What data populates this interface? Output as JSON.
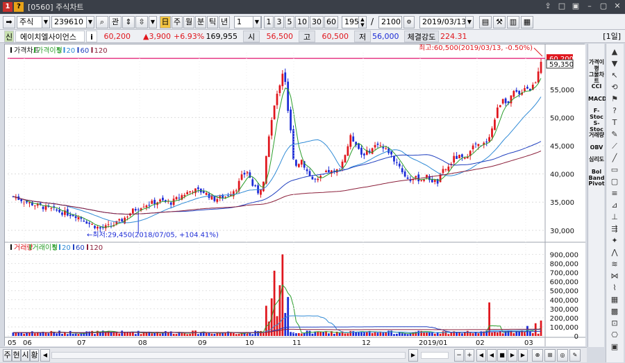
{
  "window": {
    "title": "[0560] 주식차트",
    "icon_q": "?",
    "icon_num": "1"
  },
  "toolbar": {
    "market": "주식",
    "code": "239610",
    "btn_gwan": "관",
    "period_buttons": [
      "주",
      "월",
      "분",
      "틱",
      "년"
    ],
    "interval_value": "1",
    "minute_buttons": [
      "1",
      "3",
      "5",
      "10",
      "30",
      "60"
    ],
    "count_value": "195",
    "total_value": "2100",
    "date_value": "2019/03/13"
  },
  "quote": {
    "badge": "신",
    "name": "에이치엘사이언스",
    "info_btn": "i",
    "price": "60,200",
    "change": "▲3,900",
    "change_pct": "+6.93%",
    "volume": "169,955",
    "open_label": "시",
    "open": "56,500",
    "high_label": "고",
    "high": "60,500",
    "low_label": "저",
    "low": "56,000",
    "strength_label": "체결강도",
    "strength": "224.31",
    "period_tag": "[1일]"
  },
  "price_pane": {
    "legend_title": "가격차트",
    "legend_ma_label": "가격이평",
    "legend_ma_periods": [
      "5",
      "20",
      "60",
      "120"
    ],
    "high_annotation": "최고:60,500(2019/03/13, -0.50%)",
    "low_annotation": "←최저:29,450(2018/07/05, +104.41%)",
    "current_price_tag": "59,350",
    "prev_tag": "60,200",
    "y_ticks": [
      "55,000",
      "50,000",
      "45,000",
      "40,000",
      "35,000",
      "30,000"
    ]
  },
  "volume_pane": {
    "legend_title": "거래량",
    "legend_ma_label": "거래이평",
    "legend_ma_periods": [
      "5",
      "20",
      "60",
      "120"
    ],
    "y_ticks": [
      "900,000",
      "800,000",
      "700,000",
      "600,000",
      "500,000",
      "400,000",
      "300,000",
      "200,000",
      "100,000",
      "0"
    ]
  },
  "x_axis_labels": [
    "05",
    "06",
    "07",
    "08",
    "09",
    "10",
    "11",
    "12",
    "2019/01",
    "02",
    "03"
  ],
  "bottom": {
    "tab1": "주",
    "tab2": "현",
    "tab3": "시",
    "tab4": "황"
  },
  "indicators": [
    "가격이평",
    "그물차트",
    "CCI",
    "MACD",
    "F-Stoc",
    "S-Stoc",
    "거래량",
    "OBV",
    "심리도",
    "Bol Band",
    "Pivot"
  ],
  "colors": {
    "up": "#e0161d",
    "down": "#1c2bd6",
    "ma5": "#2a9d2a",
    "ma20": "#2f8ad6",
    "ma60": "#1f3fbf",
    "ma120": "#8b1f3a",
    "high_line": "#e0126e"
  },
  "chart_data": {
    "type": "candlestick",
    "y_range": [
      28500,
      61500
    ],
    "x_labels": [
      "05",
      "06",
      "07",
      "08",
      "09",
      "10",
      "11",
      "12",
      "2019/01",
      "02",
      "03"
    ],
    "max": {
      "value": 60500,
      "date": "2019/03/13"
    },
    "min": {
      "value": 29450,
      "date": "2018/07/05"
    },
    "volume_range": [
      0,
      950000
    ]
  }
}
